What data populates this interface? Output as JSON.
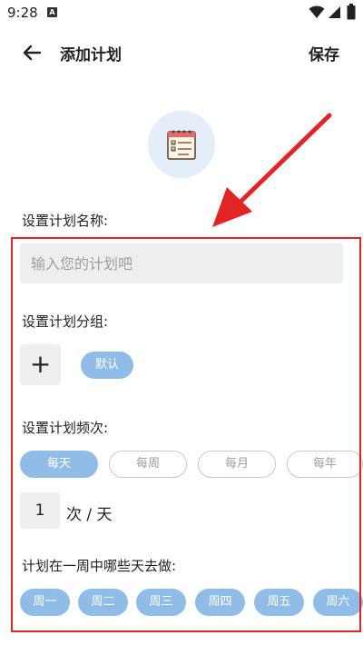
{
  "status_bar": {
    "time": "9:28",
    "notification_letter": "A"
  },
  "header": {
    "title": "添加计划",
    "save_label": "保存"
  },
  "plan_name": {
    "label": "设置计划名称:",
    "placeholder": "输入您的计划吧"
  },
  "group": {
    "label": "设置计划分组:",
    "add_symbol": "+",
    "chips": [
      "默认"
    ]
  },
  "frequency": {
    "label": "设置计划频次:",
    "options": [
      "每天",
      "每周",
      "每月",
      "每年"
    ],
    "selected": "每天",
    "count": "1",
    "unit": "次 / 天"
  },
  "weekdays": {
    "label": "计划在一周中哪些天去做:",
    "days": [
      "周一",
      "周二",
      "周三",
      "周四",
      "周五",
      "周六"
    ]
  },
  "colors": {
    "accent": "#90bde8",
    "annotation": "#e32424",
    "icon_bg": "#e3eefa"
  }
}
